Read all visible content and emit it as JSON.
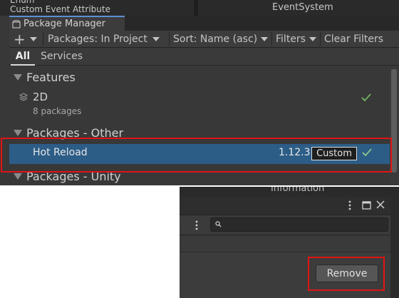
{
  "background": {
    "left_text": "Enum\nCustom Event Attribute",
    "right_text": "EventSystem"
  },
  "window": {
    "title": "Package Manager"
  },
  "toolbar": {
    "add_label": "+",
    "packages_dropdown": "Packages: In Project",
    "sort_dropdown": "Sort: Name (asc)",
    "filters_dropdown": "Filters",
    "clear_filters": "Clear Filters"
  },
  "subtabs": {
    "all": "All",
    "services": "Services"
  },
  "sections": {
    "features": "Features",
    "packages_other": "Packages - Other",
    "packages_unity": "Packages - Unity"
  },
  "packages": {
    "feature_2d": {
      "name": "2D",
      "subtitle": "8 packages"
    },
    "hot_reload": {
      "name": "Hot Reload",
      "version": "1.12.3",
      "badge": "Custom"
    }
  },
  "details": {
    "top_text": "Information",
    "remove_label": "Remove",
    "search_placeholder": ""
  },
  "colors": {
    "accent_selected": "#2c5d87",
    "check_green": "#7bc46a",
    "highlight_red": "#e01414"
  },
  "icons": [
    "package-manager-icon",
    "add-icon",
    "caret-down-icon",
    "collapse-triangle-icon",
    "feature-icon",
    "checkmark-icon",
    "more-options-icon",
    "maximize-icon",
    "close-icon",
    "search-icon"
  ]
}
